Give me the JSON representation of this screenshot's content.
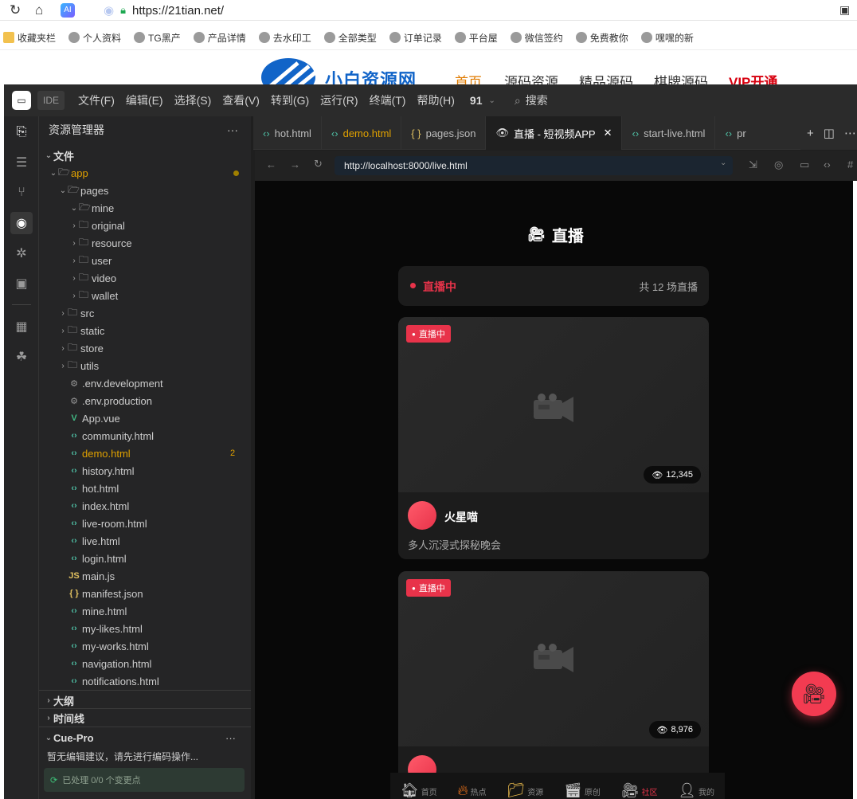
{
  "browser": {
    "url": "https://21tian.net/",
    "bookmarks": [
      "收藏夹栏",
      "个人资料",
      "TG黑产",
      "产品详情",
      "去水印工",
      "全部类型",
      "订单记录",
      "平台屋",
      "微信签约",
      "免费教你",
      "嘿嘿的新"
    ]
  },
  "site": {
    "title": "小白资源网",
    "nav": [
      "首页",
      "源码资源",
      "精品源码",
      "棋牌源码",
      "VIP开通"
    ]
  },
  "ide": {
    "badge": "IDE",
    "menus": [
      "文件(F)",
      "编辑(E)",
      "选择(S)",
      "查看(V)",
      "转到(G)",
      "运行(R)",
      "终端(T)",
      "帮助(H)"
    ],
    "counter": "91",
    "search_label": "搜索",
    "explorer": {
      "title": "资源管理器",
      "section": "文件",
      "root": "app",
      "rows": [
        {
          "label": "pages",
          "kind": "folder",
          "open": true,
          "indent": 2
        },
        {
          "label": "mine",
          "kind": "folder",
          "open": true,
          "indent": 3
        },
        {
          "label": "original",
          "kind": "folder",
          "indent": 3
        },
        {
          "label": "resource",
          "kind": "folder",
          "indent": 3
        },
        {
          "label": "user",
          "kind": "folder",
          "indent": 3
        },
        {
          "label": "video",
          "kind": "folder",
          "indent": 3
        },
        {
          "label": "wallet",
          "kind": "folder",
          "indent": 3
        },
        {
          "label": "src",
          "kind": "folder",
          "indent": 2
        },
        {
          "label": "static",
          "kind": "folder",
          "indent": 2
        },
        {
          "label": "store",
          "kind": "folder",
          "indent": 2
        },
        {
          "label": "utils",
          "kind": "folder",
          "indent": 2
        },
        {
          "label": ".env.development",
          "kind": "gear",
          "indent": 2
        },
        {
          "label": ".env.production",
          "kind": "gear",
          "indent": 2
        },
        {
          "label": "App.vue",
          "kind": "vue",
          "indent": 2
        },
        {
          "label": "community.html",
          "kind": "html",
          "indent": 2
        },
        {
          "label": "demo.html",
          "kind": "html",
          "indent": 2,
          "modified": true,
          "badge": "2"
        },
        {
          "label": "history.html",
          "kind": "html",
          "indent": 2
        },
        {
          "label": "hot.html",
          "kind": "html",
          "indent": 2
        },
        {
          "label": "index.html",
          "kind": "html",
          "indent": 2
        },
        {
          "label": "live-room.html",
          "kind": "html",
          "indent": 2
        },
        {
          "label": "live.html",
          "kind": "html",
          "indent": 2
        },
        {
          "label": "login.html",
          "kind": "html",
          "indent": 2
        },
        {
          "label": "main.js",
          "kind": "js",
          "indent": 2
        },
        {
          "label": "manifest.json",
          "kind": "json",
          "indent": 2
        },
        {
          "label": "mine.html",
          "kind": "html",
          "indent": 2
        },
        {
          "label": "my-likes.html",
          "kind": "html",
          "indent": 2
        },
        {
          "label": "my-works.html",
          "kind": "html",
          "indent": 2
        },
        {
          "label": "navigation.html",
          "kind": "html",
          "indent": 2
        },
        {
          "label": "notifications.html",
          "kind": "html",
          "indent": 2
        }
      ],
      "outline": "大纲",
      "timeline": "时间线",
      "cue_title": "Cue-Pro",
      "cue_text": "暂无编辑建议，请先进行编码操作...",
      "cue_status": "已处理 0/0 个变更点"
    },
    "tabs": [
      {
        "label": "hot.html",
        "kind": "html"
      },
      {
        "label": "demo.html",
        "kind": "html",
        "modified": true
      },
      {
        "label": "pages.json",
        "kind": "json"
      },
      {
        "label": "直播 - 短视频APP",
        "kind": "preview",
        "active": true
      },
      {
        "label": "start-live.html",
        "kind": "html"
      },
      {
        "label": "pr",
        "kind": "html"
      }
    ],
    "address": "http://localhost:8000/live.html"
  },
  "live_page": {
    "title": "直播",
    "status_label": "直播中",
    "count_label": "共 12 场直播",
    "badge_label": "直播中",
    "cards": [
      {
        "views": "12,345",
        "host": "火星喵",
        "desc": "多人沉浸式探秘晚会"
      },
      {
        "views": "8,976",
        "host": "",
        "desc": ""
      }
    ],
    "bottom_nav": [
      "首页",
      "热点",
      "资源",
      "原创",
      "社区",
      "我的"
    ],
    "active_nav_color": "#e8334a"
  },
  "colors": {
    "accent_orange": "#e0a100",
    "live_red": "#e8334a",
    "site_blue": "#1164c8",
    "vip_red": "#d7000f"
  }
}
